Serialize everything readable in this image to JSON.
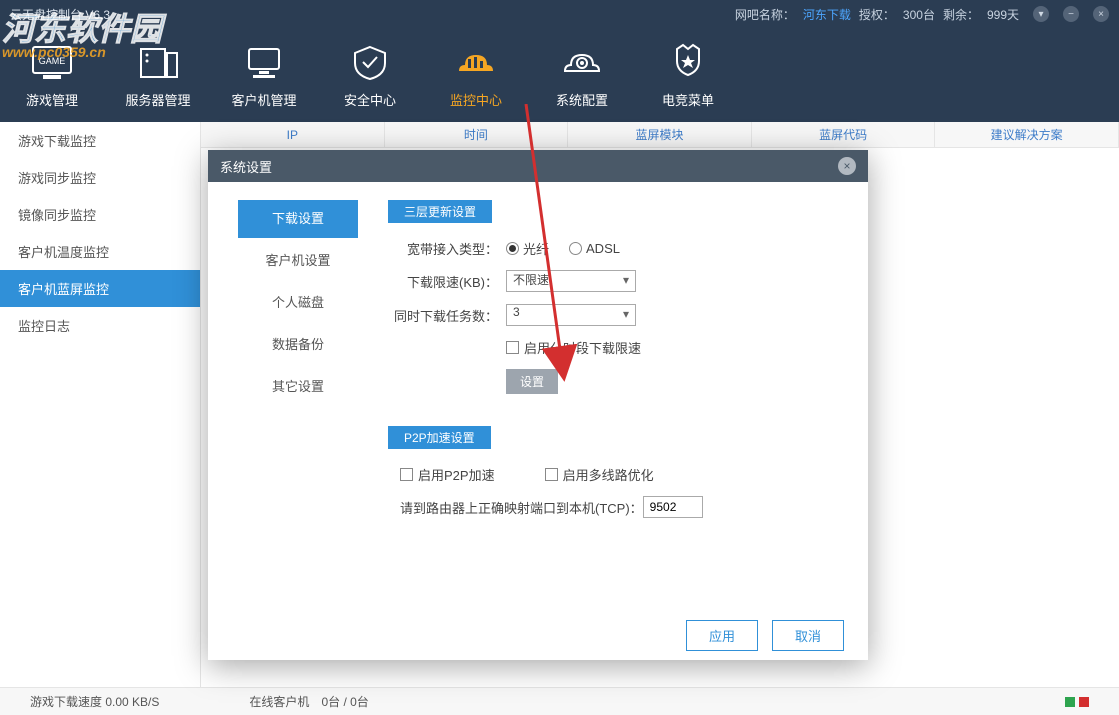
{
  "app_title": "云无盘控制台 V6.3",
  "header_info": {
    "bar_name_label": "网吧名称：",
    "bar_name_value": "河东下载",
    "auth_label": "授权：",
    "auth_value": "300台",
    "remain_label": "剩余：",
    "remain_value": "999天"
  },
  "nav": [
    {
      "label": "游戏管理",
      "icon": "game"
    },
    {
      "label": "服务器管理",
      "icon": "server"
    },
    {
      "label": "客户机管理",
      "icon": "client"
    },
    {
      "label": "安全中心",
      "icon": "shield"
    },
    {
      "label": "监控中心",
      "icon": "monitor",
      "active": true
    },
    {
      "label": "系统配置",
      "icon": "gear"
    },
    {
      "label": "电竞菜单",
      "icon": "esports"
    }
  ],
  "sidebar": {
    "items": [
      {
        "label": "游戏下载监控"
      },
      {
        "label": "游戏同步监控"
      },
      {
        "label": "镜像同步监控"
      },
      {
        "label": "客户机温度监控"
      },
      {
        "label": "客户机蓝屏监控",
        "active": true
      },
      {
        "label": "监控日志"
      }
    ]
  },
  "table_headers": [
    "IP",
    "时间",
    "蓝屏模块",
    "蓝屏代码",
    "建议解决方案"
  ],
  "dialog": {
    "title": "系统设置",
    "nav": [
      {
        "label": "下载设置",
        "active": true
      },
      {
        "label": "客户机设置"
      },
      {
        "label": "个人磁盘"
      },
      {
        "label": "数据备份"
      },
      {
        "label": "其它设置"
      }
    ],
    "section1": {
      "title": "三层更新设置",
      "bandwidth_label": "宽带接入类型：",
      "radio1": "光纤",
      "radio2": "ADSL",
      "limit_label": "下载限速(KB)：",
      "limit_value": "不限速",
      "tasks_label": "同时下载任务数：",
      "tasks_value": "3",
      "time_limit": "启用分时段下载限速",
      "set_btn": "设置"
    },
    "section2": {
      "title": "P2P加速设置",
      "enable_p2p": "启用P2P加速",
      "multi_route": "启用多线路优化",
      "port_label": "请到路由器上正确映射端口到本机(TCP)：",
      "port_value": "9502"
    },
    "apply": "应用",
    "cancel": "取消"
  },
  "status": {
    "speed_label": "游戏下载速度",
    "speed_value": "0.00 KB/S",
    "online_label": "在线客户机",
    "online_value": "0台 / 0台"
  },
  "watermark": {
    "cn": "河东软件园",
    "en": "www.pc0359.cn"
  }
}
